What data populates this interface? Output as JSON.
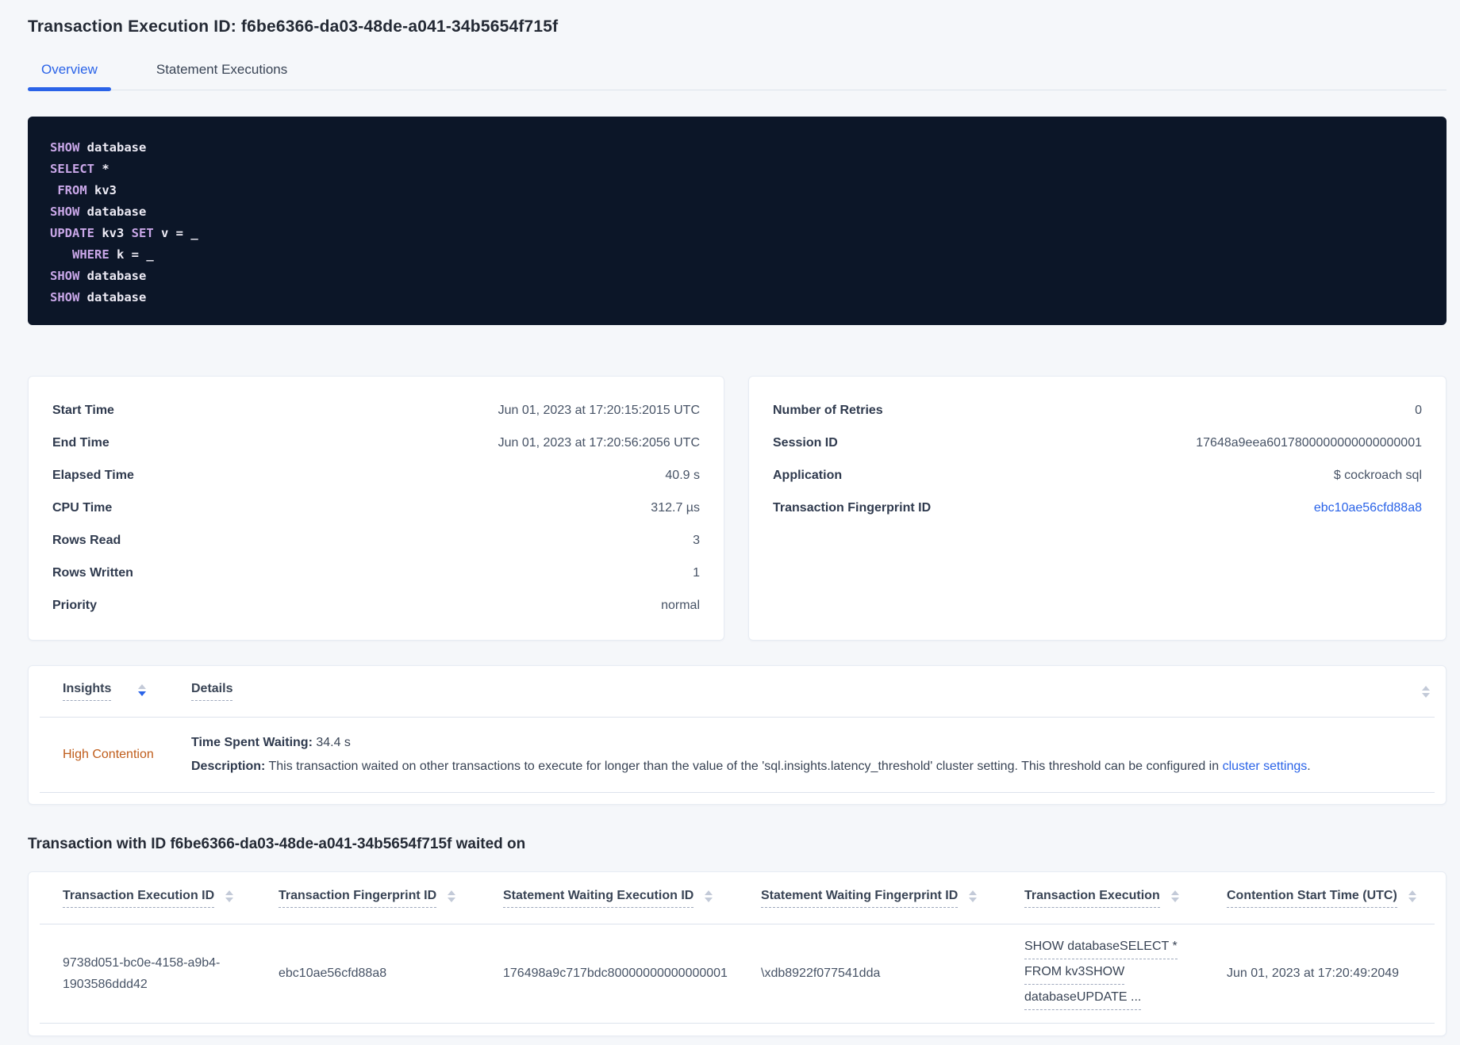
{
  "page": {
    "title": "Transaction Execution ID: f6be6366-da03-48de-a041-34b5654f715f"
  },
  "tabs": [
    {
      "label": "Overview"
    },
    {
      "label": "Statement Executions"
    }
  ],
  "sql": {
    "lines": [
      [
        {
          "t": "SHOW",
          "kw": true
        },
        {
          "t": " database",
          "kw": false
        }
      ],
      [
        {
          "t": "SELECT",
          "kw": true
        },
        {
          "t": " *",
          "kw": false
        }
      ],
      [
        {
          "t": " ",
          "kw": false
        },
        {
          "t": "FROM",
          "kw": true
        },
        {
          "t": " kv3",
          "kw": false
        }
      ],
      [
        {
          "t": "SHOW",
          "kw": true
        },
        {
          "t": " database",
          "kw": false
        }
      ],
      [
        {
          "t": "UPDATE",
          "kw": true
        },
        {
          "t": " kv3 ",
          "kw": false
        },
        {
          "t": "SET",
          "kw": true
        },
        {
          "t": " v = _",
          "kw": false
        }
      ],
      [
        {
          "t": "   ",
          "kw": false
        },
        {
          "t": "WHERE",
          "kw": true
        },
        {
          "t": " k = _",
          "kw": false
        }
      ],
      [
        {
          "t": "SHOW",
          "kw": true
        },
        {
          "t": " database",
          "kw": false
        }
      ],
      [
        {
          "t": "SHOW",
          "kw": true
        },
        {
          "t": " database",
          "kw": false
        }
      ]
    ]
  },
  "summary_left": {
    "rows": [
      {
        "label": "Start Time",
        "value": "Jun 01, 2023 at 17:20:15:2015 UTC"
      },
      {
        "label": "End Time",
        "value": "Jun 01, 2023 at 17:20:56:2056 UTC"
      },
      {
        "label": "Elapsed Time",
        "value": "40.9 s"
      },
      {
        "label": "CPU Time",
        "value": "312.7 µs"
      },
      {
        "label": "Rows Read",
        "value": "3"
      },
      {
        "label": "Rows Written",
        "value": "1"
      },
      {
        "label": "Priority",
        "value": "normal"
      }
    ]
  },
  "summary_right": {
    "rows": [
      {
        "label": "Number of Retries",
        "value": "0"
      },
      {
        "label": "Session ID",
        "value": "17648a9eea6017800000000000000001"
      },
      {
        "label": "Application",
        "value": "$ cockroach sql"
      },
      {
        "label": "Transaction Fingerprint ID",
        "value": "ebc10ae56cfd88a8",
        "link": true
      }
    ]
  },
  "insights_table": {
    "insights_header": "Insights",
    "details_header": "Details",
    "row": {
      "insight_label": "High Contention",
      "waiting_label": "Time Spent Waiting:",
      "waiting_value": " 34.4 s",
      "description_label": "Description:",
      "description_text": " This transaction waited on other transactions to execute for longer than the value of the 'sql.insights.latency_threshold' cluster setting. This threshold can be configured in ",
      "description_link": "cluster settings",
      "description_suffix": "."
    }
  },
  "waited_section": {
    "heading": "Transaction with ID f6be6366-da03-48de-a041-34b5654f715f waited on"
  },
  "waited_table": {
    "columns": [
      "Transaction Execution ID",
      "Transaction Fingerprint ID",
      "Statement Waiting Execution ID",
      "Statement Waiting Fingerprint ID",
      "Transaction Execution",
      "Contention Start Time (UTC)"
    ],
    "row": {
      "transaction_execution_id": "9738d051-bc0e-4158-a9b4-1903586ddd42",
      "transaction_fingerprint_id": "ebc10ae56cfd88a8",
      "statement_waiting_execution_id": "176498a9c717bdc80000000000000001",
      "statement_waiting_fingerprint_id": "\\xdb8922f077541dda",
      "transaction_execution": [
        "SHOW databaseSELECT *",
        "FROM kv3SHOW",
        "databaseUPDATE ..."
      ],
      "contention_start_time": "Jun 01, 2023 at 17:20:49:2049"
    }
  },
  "colors": {
    "accent_blue": "#2a63e8",
    "insight_orange": "#bf5c1a",
    "code_background": "#0c1628",
    "code_keyword": "#c9a7e8"
  }
}
